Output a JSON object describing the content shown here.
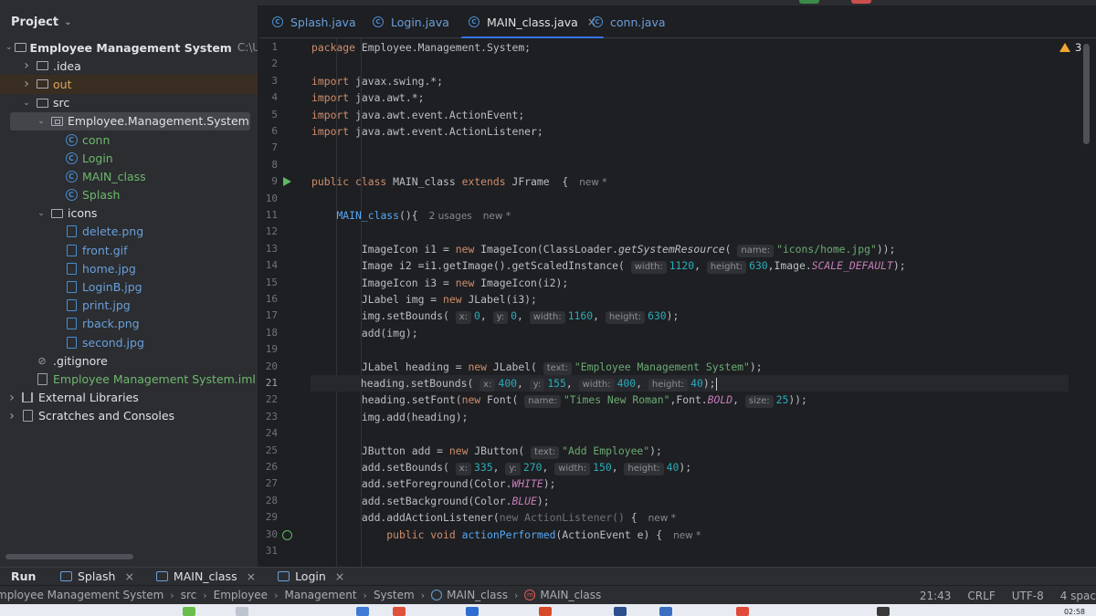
{
  "colors": {
    "accent": "#3574f0",
    "run_green": "#5fb865",
    "warning": "#f0a732"
  },
  "project": {
    "title": "Project",
    "tree": [
      {
        "indent": 0,
        "arrow": "down",
        "icon": "module-icon",
        "label": "Employee Management System",
        "path": "C:\\Users\\a",
        "style": "norm",
        "bold": true
      },
      {
        "indent": 1,
        "arrow": "right",
        "icon": "folder-icon",
        "label": ".idea",
        "style": "norm"
      },
      {
        "indent": 1,
        "arrow": "right",
        "icon": "folder-icon",
        "label": "out",
        "style": "out",
        "excluded": true
      },
      {
        "indent": 1,
        "arrow": "down",
        "icon": "folder-icon",
        "label": "src",
        "style": "norm"
      },
      {
        "indent": 2,
        "arrow": "down",
        "icon": "package-icon",
        "label": "Employee.Management.System",
        "style": "norm",
        "selected": true
      },
      {
        "indent": 3,
        "arrow": "",
        "icon": "class-icon",
        "label": "conn",
        "style": "cls"
      },
      {
        "indent": 3,
        "arrow": "",
        "icon": "class-icon",
        "label": "Login",
        "style": "cls"
      },
      {
        "indent": 3,
        "arrow": "",
        "icon": "class-icon",
        "label": "MAIN_class",
        "style": "cls"
      },
      {
        "indent": 3,
        "arrow": "",
        "icon": "class-icon",
        "label": "Splash",
        "style": "cls"
      },
      {
        "indent": 2,
        "arrow": "down",
        "icon": "folder-icon",
        "label": "icons",
        "style": "norm"
      },
      {
        "indent": 3,
        "arrow": "",
        "icon": "image-file-icon",
        "label": "delete.png",
        "style": "img"
      },
      {
        "indent": 3,
        "arrow": "",
        "icon": "image-file-icon",
        "label": "front.gif",
        "style": "img"
      },
      {
        "indent": 3,
        "arrow": "",
        "icon": "image-file-icon",
        "label": "home.jpg",
        "style": "img"
      },
      {
        "indent": 3,
        "arrow": "",
        "icon": "image-file-icon",
        "label": "LoginB.jpg",
        "style": "img"
      },
      {
        "indent": 3,
        "arrow": "",
        "icon": "image-file-icon",
        "label": "print.jpg",
        "style": "img"
      },
      {
        "indent": 3,
        "arrow": "",
        "icon": "image-file-icon",
        "label": "rback.png",
        "style": "img"
      },
      {
        "indent": 3,
        "arrow": "",
        "icon": "image-file-icon",
        "label": "second.jpg",
        "style": "img"
      },
      {
        "indent": 1,
        "arrow": "",
        "icon": "gitignore-file-icon",
        "label": ".gitignore",
        "style": "norm"
      },
      {
        "indent": 1,
        "arrow": "",
        "icon": "iml-file-icon",
        "label": "Employee Management System.iml",
        "style": "iml"
      },
      {
        "indent": 0,
        "arrow": "right",
        "icon": "library-icon",
        "label": "External Libraries",
        "style": "norm"
      },
      {
        "indent": 0,
        "arrow": "right",
        "icon": "scratches-icon",
        "label": "Scratches and Consoles",
        "style": "norm"
      }
    ]
  },
  "tabs": [
    {
      "label": "Splash.java",
      "active": false,
      "close": ""
    },
    {
      "label": "Login.java",
      "active": false,
      "close": ""
    },
    {
      "label": "MAIN_class.java",
      "active": true,
      "close": "×"
    },
    {
      "label": "conn.java",
      "active": false,
      "close": ""
    }
  ],
  "warnings": {
    "count": "3"
  },
  "editor": {
    "current_line": 21,
    "lines": [
      [
        [
          "kw",
          "package"
        ],
        [
          "p",
          " Employee.Management.System;"
        ]
      ],
      [],
      [
        [
          "kw",
          "import"
        ],
        [
          "p",
          " javax.swing.*;"
        ]
      ],
      [
        [
          "kw",
          "import"
        ],
        [
          "p",
          " java.awt.*;"
        ]
      ],
      [
        [
          "kw",
          "import"
        ],
        [
          "p",
          " java.awt.event.ActionEvent;"
        ]
      ],
      [
        [
          "kw",
          "import"
        ],
        [
          "p",
          " java.awt.event.ActionListener;"
        ]
      ],
      [],
      [],
      [
        [
          "kw",
          "public class"
        ],
        [
          "p",
          " MAIN_class "
        ],
        [
          "kw",
          "extends"
        ],
        [
          "p",
          " JFrame  {"
        ],
        [
          "meta",
          "new *"
        ]
      ],
      [],
      [
        [
          "p",
          "    "
        ],
        [
          "fn",
          "MAIN_class"
        ],
        [
          "p",
          "(){"
        ],
        [
          "meta",
          "2 usages"
        ],
        [
          "meta",
          "new *"
        ]
      ],
      [],
      [
        [
          "p",
          "        ImageIcon i1 = "
        ],
        [
          "kw",
          "new"
        ],
        [
          "p",
          " ImageIcon(ClassLoader."
        ],
        [
          "it",
          "getSystemResource"
        ],
        [
          "p",
          "( "
        ],
        [
          "hint",
          "name:"
        ],
        [
          "str",
          "\"icons/home.jpg\""
        ],
        [
          "p",
          "));"
        ]
      ],
      [
        [
          "p",
          "        Image i2 =i1.getImage().getScaledInstance( "
        ],
        [
          "hint",
          "width:"
        ],
        [
          "num",
          "1120"
        ],
        [
          "p",
          ", "
        ],
        [
          "hint",
          "height:"
        ],
        [
          "num",
          "630"
        ],
        [
          "p",
          ",Image."
        ],
        [
          "const",
          "SCALE_DEFAULT"
        ],
        [
          "p",
          ");"
        ]
      ],
      [
        [
          "p",
          "        ImageIcon i3 = "
        ],
        [
          "kw",
          "new"
        ],
        [
          "p",
          " ImageIcon(i2);"
        ]
      ],
      [
        [
          "p",
          "        JLabel img = "
        ],
        [
          "kw",
          "new"
        ],
        [
          "p",
          " JLabel(i3);"
        ]
      ],
      [
        [
          "p",
          "        img.setBounds( "
        ],
        [
          "hint",
          "x:"
        ],
        [
          "num",
          "0"
        ],
        [
          "p",
          ", "
        ],
        [
          "hint",
          "y:"
        ],
        [
          "num",
          "0"
        ],
        [
          "p",
          ", "
        ],
        [
          "hint",
          "width:"
        ],
        [
          "num",
          "1160"
        ],
        [
          "p",
          ", "
        ],
        [
          "hint",
          "height:"
        ],
        [
          "num",
          "630"
        ],
        [
          "p",
          ");"
        ]
      ],
      [
        [
          "p",
          "        add(img);"
        ]
      ],
      [],
      [
        [
          "p",
          "        JLabel heading = "
        ],
        [
          "kw",
          "new"
        ],
        [
          "p",
          " JLabel( "
        ],
        [
          "hint",
          "text:"
        ],
        [
          "str",
          "\"Employee Management System\""
        ],
        [
          "p",
          ");"
        ]
      ],
      [
        [
          "p",
          "        heading.setBounds( "
        ],
        [
          "hint",
          "x:"
        ],
        [
          "num",
          "400"
        ],
        [
          "p",
          ", "
        ],
        [
          "hint",
          "y:"
        ],
        [
          "num",
          "155"
        ],
        [
          "p",
          ", "
        ],
        [
          "hint",
          "width:"
        ],
        [
          "num",
          "400"
        ],
        [
          "p",
          ", "
        ],
        [
          "hint",
          "height:"
        ],
        [
          "num",
          "40"
        ],
        [
          "p",
          ");"
        ],
        [
          "caret",
          ""
        ]
      ],
      [
        [
          "p",
          "        heading.setFont("
        ],
        [
          "kw",
          "new"
        ],
        [
          "p",
          " Font( "
        ],
        [
          "hint",
          "name:"
        ],
        [
          "str",
          "\"Times New Roman\""
        ],
        [
          "p",
          ",Font."
        ],
        [
          "const",
          "BOLD"
        ],
        [
          "p",
          ", "
        ],
        [
          "hint",
          "size:"
        ],
        [
          "num",
          "25"
        ],
        [
          "p",
          "));"
        ]
      ],
      [
        [
          "p",
          "        img.add(heading);"
        ]
      ],
      [],
      [
        [
          "p",
          "        JButton add = "
        ],
        [
          "kw",
          "new"
        ],
        [
          "p",
          " JButton( "
        ],
        [
          "hint",
          "text:"
        ],
        [
          "str",
          "\"Add Employee\""
        ],
        [
          "p",
          ");"
        ]
      ],
      [
        [
          "p",
          "        add.setBounds( "
        ],
        [
          "hint",
          "x:"
        ],
        [
          "num",
          "335"
        ],
        [
          "p",
          ", "
        ],
        [
          "hint",
          "y:"
        ],
        [
          "num",
          "270"
        ],
        [
          "p",
          ", "
        ],
        [
          "hint",
          "width:"
        ],
        [
          "num",
          "150"
        ],
        [
          "p",
          ", "
        ],
        [
          "hint",
          "height:"
        ],
        [
          "num",
          "40"
        ],
        [
          "p",
          ");"
        ]
      ],
      [
        [
          "p",
          "        add.setForeground(Color."
        ],
        [
          "const",
          "WHITE"
        ],
        [
          "p",
          ");"
        ]
      ],
      [
        [
          "p",
          "        add.setBackground(Color."
        ],
        [
          "const",
          "BLUE"
        ],
        [
          "p",
          ");"
        ]
      ],
      [
        [
          "p",
          "        add.addActionListener("
        ],
        [
          "dim",
          "new ActionListener()"
        ],
        [
          "p",
          " {"
        ],
        [
          "meta",
          "new *"
        ]
      ],
      [
        [
          "p",
          "            "
        ],
        [
          "kw",
          "public void"
        ],
        [
          "p",
          " "
        ],
        [
          "fn",
          "actionPerformed"
        ],
        [
          "p",
          "(ActionEvent e) {"
        ],
        [
          "meta",
          "new *"
        ]
      ],
      []
    ],
    "gutter_icons": {
      "9": "run-icon",
      "30": "override-icon"
    }
  },
  "run_bar": {
    "label": "Run",
    "tabs": [
      {
        "label": "Splash",
        "close": "×"
      },
      {
        "label": "MAIN_class",
        "close": "×"
      },
      {
        "label": "Login",
        "close": "×"
      }
    ]
  },
  "status_bar": {
    "breadcrumbs": [
      "mployee Management System",
      "src",
      "Employee",
      "Management",
      "System",
      "MAIN_class",
      "MAIN_class"
    ],
    "position": "21:43",
    "line_separator": "CRLF",
    "encoding": "UTF-8",
    "indent": "4 spac"
  },
  "taskbar": {
    "time": "02:58"
  }
}
